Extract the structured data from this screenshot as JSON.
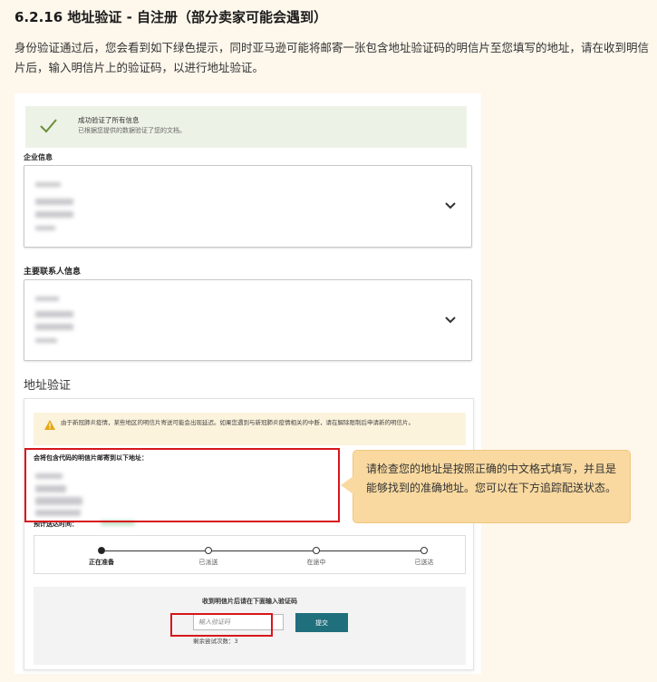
{
  "doc": {
    "heading": "6.2.16 地址验证 - 自注册（部分卖家可能会遇到）",
    "intro": "身份验证通过后，您会看到如下绿色提示，同时亚马逊可能将邮寄一张包含地址验证码的明信片至您填写的地址，请在收到明信片后，输入明信片上的验证码，以进行地址验证。"
  },
  "success_banner": {
    "title": "成功验证了所有信息",
    "subtitle": "已根据您提供的数据验证了您的文档。",
    "icon": "check-icon",
    "color": "#6a8f3a"
  },
  "business_info": {
    "label": "企业信息"
  },
  "primary_contact": {
    "label": "主要联系人信息"
  },
  "address_verification": {
    "section_title": "地址验证",
    "warning": "由于新冠肺炎疫情，某些地区的明信片寄送可能会出现延迟。如果您遇到与新冠肺炎疫情相关的中断，请在解除限制后申请新的明信片。",
    "mail_to_label": "会将包含代码的明信片邮寄到以下地址：",
    "eta_label": "预计送达时间：",
    "steps": [
      "正在准备",
      "已派送",
      "在途中",
      "已送达"
    ],
    "current_step": 0,
    "verify_prompt": "收到明信片后请在下面输入验证码",
    "code_placeholder": "输入验证码",
    "submit_label": "提交",
    "remaining_attempts": "剩余尝试次数：3"
  },
  "callout": {
    "text": "请检查您的地址是按照正确的中文格式填写，并且是能够找到的准确地址。您可以在下方追踪配送状态。"
  },
  "colors": {
    "highlight_border": "#d8161b",
    "callout_bg": "#f9d9a0",
    "submit_bg": "#1f6f7d",
    "warning_bg": "#fcf3dc"
  }
}
